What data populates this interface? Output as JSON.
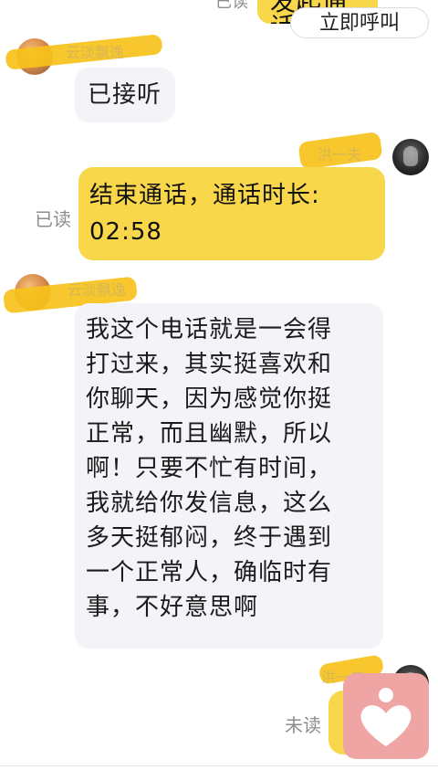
{
  "top": {
    "read_status": "已读",
    "bubble_text": "发起通话",
    "call_button": "立即呼叫"
  },
  "messages": [
    {
      "sender": "云淡飘逸",
      "side": "left",
      "text": "已接听"
    },
    {
      "sender": "洪一夫",
      "side": "right",
      "status": "已读",
      "text_line1": "结束通话，通话时长:",
      "text_line2": "02:58"
    },
    {
      "sender": "云淡飘逸",
      "side": "left",
      "lines": [
        "我这个电话就是一会得",
        "打过来，其实挺喜欢和",
        "你聊天，因为感觉你挺",
        "正常，而且幽默，所以",
        "啊！只要不忙有时间，",
        "我就给你发信息，这么",
        "多天挺郁闷，终于遇到",
        "一个正常人，确临时有",
        "事，不好意思啊"
      ]
    },
    {
      "sender": "洪一夫",
      "side": "right",
      "status": "未读"
    }
  ],
  "colors": {
    "outgoing_bubble": "#f8d74a",
    "incoming_bubble": "#f3f3f8",
    "heart_button": "#f0a5a5"
  },
  "icons": {
    "floating_button": "heart-icon"
  }
}
